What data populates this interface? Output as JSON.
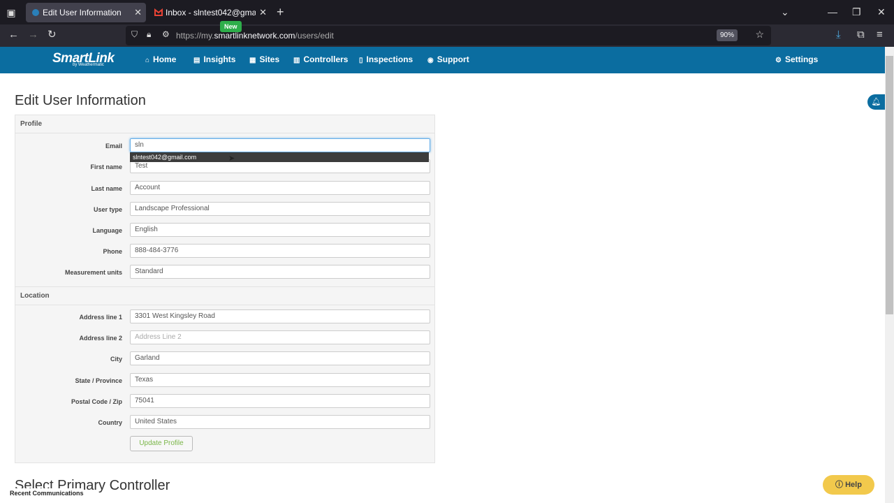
{
  "browser": {
    "tabs": [
      {
        "title": "Edit User Information",
        "close": "✕"
      },
      {
        "title": "Inbox - slntest042@gmail.com -",
        "close": "✕"
      }
    ],
    "new_tab": "+",
    "url_host": "https://my.",
    "url_domain": "smartlinknetwork.com",
    "url_path": "/users/edit",
    "zoom": "90%"
  },
  "site": {
    "logo": "SmartLink",
    "logo_sub": "by Weathermatic",
    "nav": [
      "Home",
      "Insights",
      "Sites",
      "Controllers",
      "Inspections",
      "Support"
    ],
    "settings": "Settings",
    "new_badge": "New"
  },
  "page": {
    "title": "Edit User Information",
    "profile_heading": "Profile",
    "location_heading": "Location",
    "profile_fields": [
      {
        "label": "Email",
        "value": "sln"
      },
      {
        "label": "First name",
        "value": "Test"
      },
      {
        "label": "Last name",
        "value": "Account"
      },
      {
        "label": "User type",
        "value": "Landscape Professional"
      },
      {
        "label": "Language",
        "value": "English"
      },
      {
        "label": "Phone",
        "value": "888-484-3776"
      },
      {
        "label": "Measurement units",
        "value": "Standard"
      }
    ],
    "location_fields": [
      {
        "label": "Address line 1",
        "value": "3301 West Kingsley Road"
      },
      {
        "label": "Address line 2",
        "placeholder": "Address Line 2"
      },
      {
        "label": "City",
        "value": "Garland"
      },
      {
        "label": "State / Province",
        "value": "Texas"
      },
      {
        "label": "Postal Code / Zip",
        "value": "75041"
      },
      {
        "label": "Country",
        "value": "United States"
      }
    ],
    "autocomplete": "slntest042@gmail.com",
    "update_button": "Update Profile",
    "next_section": "Select Primary Controller",
    "recent_communications": "Recent Communications",
    "help": "Help"
  }
}
